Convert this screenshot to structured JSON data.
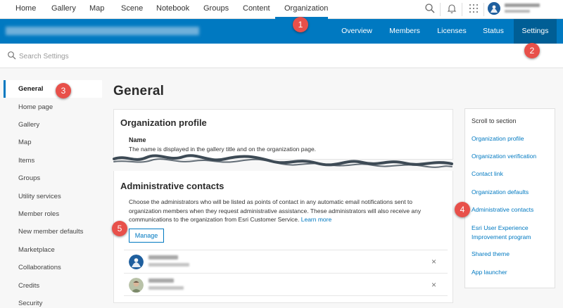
{
  "topnav": {
    "items": [
      "Home",
      "Gallery",
      "Map",
      "Scene",
      "Notebook",
      "Groups",
      "Content",
      "Organization"
    ],
    "active": "Organization",
    "icons": [
      "search-icon",
      "bell-icon",
      "apps-grid-icon"
    ]
  },
  "orgbar": {
    "tabs": [
      "Overview",
      "Members",
      "Licenses",
      "Status",
      "Settings"
    ],
    "active": "Settings"
  },
  "search": {
    "placeholder": "Search Settings"
  },
  "sidebar": {
    "items": [
      "General",
      "Home page",
      "Gallery",
      "Map",
      "Items",
      "Groups",
      "Utility services",
      "Member roles",
      "New member defaults",
      "Marketplace",
      "Collaborations",
      "Credits",
      "Security"
    ],
    "active": "General"
  },
  "main": {
    "title": "General",
    "org_profile": {
      "title": "Organization profile",
      "name_label": "Name",
      "name_help": "The name is displayed in the gallery title and on the organization page."
    },
    "admin_contacts": {
      "title": "Administrative contacts",
      "description": "Choose the administrators who will be listed as points of contact in any automatic email notifications sent to organization members when they request administrative assistance. These administrators will also receive any communications to the organization from Esri Customer Service.",
      "learn_more": "Learn more",
      "manage_label": "Manage",
      "remove_glyph": "×"
    }
  },
  "scroll_panel": {
    "title": "Scroll to section",
    "links": [
      "Organization profile",
      "Organization verification",
      "Contact link",
      "Organization defaults",
      "Administrative contacts",
      "Esri User Experience Improvement program",
      "Shared theme",
      "App launcher"
    ]
  },
  "callouts": [
    "1",
    "2",
    "3",
    "4",
    "5"
  ],
  "colors": {
    "accent": "#0079c1",
    "active_tab": "#005e95",
    "callout": "#e8504a"
  }
}
